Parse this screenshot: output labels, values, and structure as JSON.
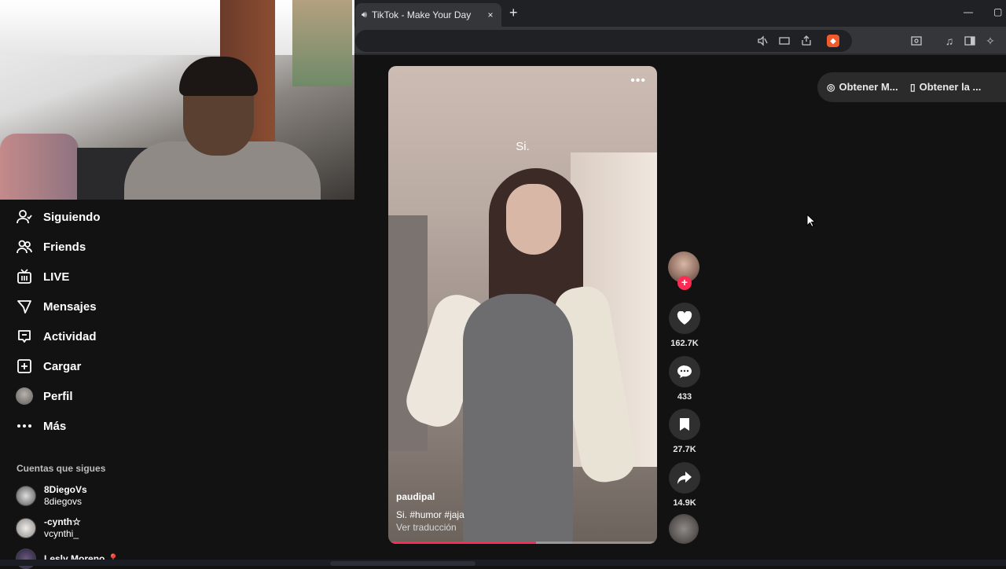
{
  "browser": {
    "tab_title": "TikTok - Make Your Day",
    "tab_audio_icon": "speaker-icon",
    "close_icon": "×",
    "new_tab_icon": "+",
    "window_minimize": "—",
    "window_restore": "▢",
    "toolbar_icons": [
      "mute-icon",
      "cast-icon",
      "share-icon",
      "brave-shield-icon",
      "screenshot-icon",
      "media-icon",
      "sidebar-icon",
      "leo-ai-icon"
    ]
  },
  "sidebar": {
    "items": [
      {
        "label": "Siguiendo",
        "icon": "following-icon"
      },
      {
        "label": "Friends",
        "icon": "friends-icon"
      },
      {
        "label": "LIVE",
        "icon": "live-icon"
      },
      {
        "label": "Mensajes",
        "icon": "messages-icon"
      },
      {
        "label": "Actividad",
        "icon": "activity-icon"
      },
      {
        "label": "Cargar",
        "icon": "upload-icon"
      },
      {
        "label": "Perfil",
        "icon": "profile-avatar"
      },
      {
        "label": "Más",
        "icon": "more-icon"
      }
    ],
    "following_title": "Cuentas que sigues",
    "accounts": [
      {
        "name": "8DiegoVs",
        "handle": "8diegovs"
      },
      {
        "name": "-cynth☆",
        "handle": "vcynthi_"
      },
      {
        "name": "Lesly Moreno 📍",
        "handle": ""
      }
    ]
  },
  "video": {
    "overlay_caption": "Si.",
    "more_icon": "•••",
    "username": "paudipal",
    "description_text": "Si.",
    "hashtags": [
      "#humor",
      "#jaja"
    ],
    "translate_label": "Ver traducción",
    "progress": 0.55
  },
  "actions": {
    "likes": "162.7K",
    "comments": "433",
    "saves": "27.7K",
    "shares": "14.9K",
    "follow_plus": "+"
  },
  "top_links": {
    "get_app": "Obtener M...",
    "get_desktop": "Obtener la ..."
  },
  "colors": {
    "accent": "#fe2c55",
    "background": "#121212",
    "browser_frame": "#202124"
  }
}
